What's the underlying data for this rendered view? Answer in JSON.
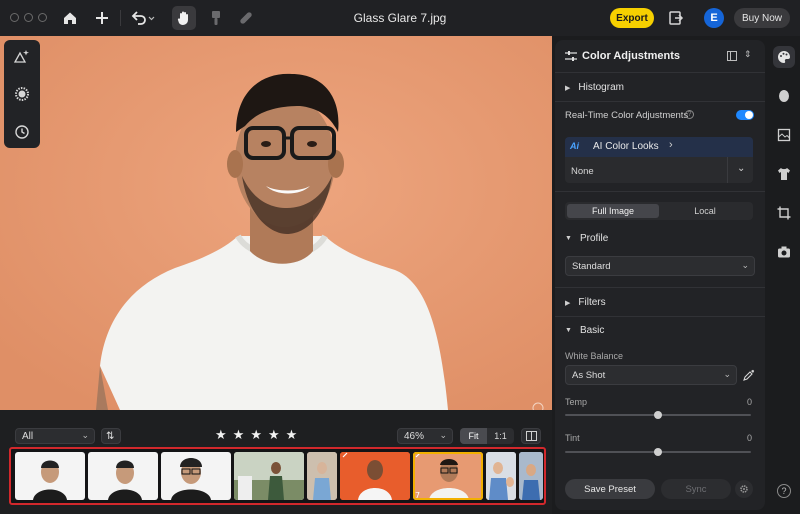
{
  "titlebar": {
    "title": "Glass Glare 7.jpg",
    "export_label": "Export",
    "avatar_initial": "E",
    "buy_label": "Buy Now"
  },
  "filter": {
    "selected": "All"
  },
  "rating": {
    "stars": [
      "★",
      "★",
      "★",
      "★",
      "★"
    ]
  },
  "zoom": {
    "value": "46%",
    "fit_label": "Fit",
    "one_to_one_label": "1:1"
  },
  "filmstrip": {
    "count": 9
  },
  "panel": {
    "title": "Color Adjustments",
    "histogram": "Histogram",
    "realtime_label": "Real-Time Color Adjustments",
    "realtime_on": true,
    "ai_badge": "Ai",
    "ai_looks_label": "AI Color Looks",
    "ai_looks_value": "None",
    "tabs": [
      "Full Image",
      "Local"
    ],
    "profile_label": "Profile",
    "profile_value": "Standard",
    "filters_label": "Filters",
    "basic_label": "Basic",
    "white_balance_label": "White Balance",
    "white_balance_value": "As Shot",
    "temp_label": "Temp",
    "temp_value": "0",
    "tint_label": "Tint",
    "tint_value": "0",
    "save_preset_label": "Save Preset",
    "sync_label": "Sync"
  },
  "colors": {
    "accent": "#1e88ff",
    "export": "#f6d000",
    "avatar": "#1565d8",
    "highlight": "#d2282c",
    "background_photo": "#e79a72"
  }
}
